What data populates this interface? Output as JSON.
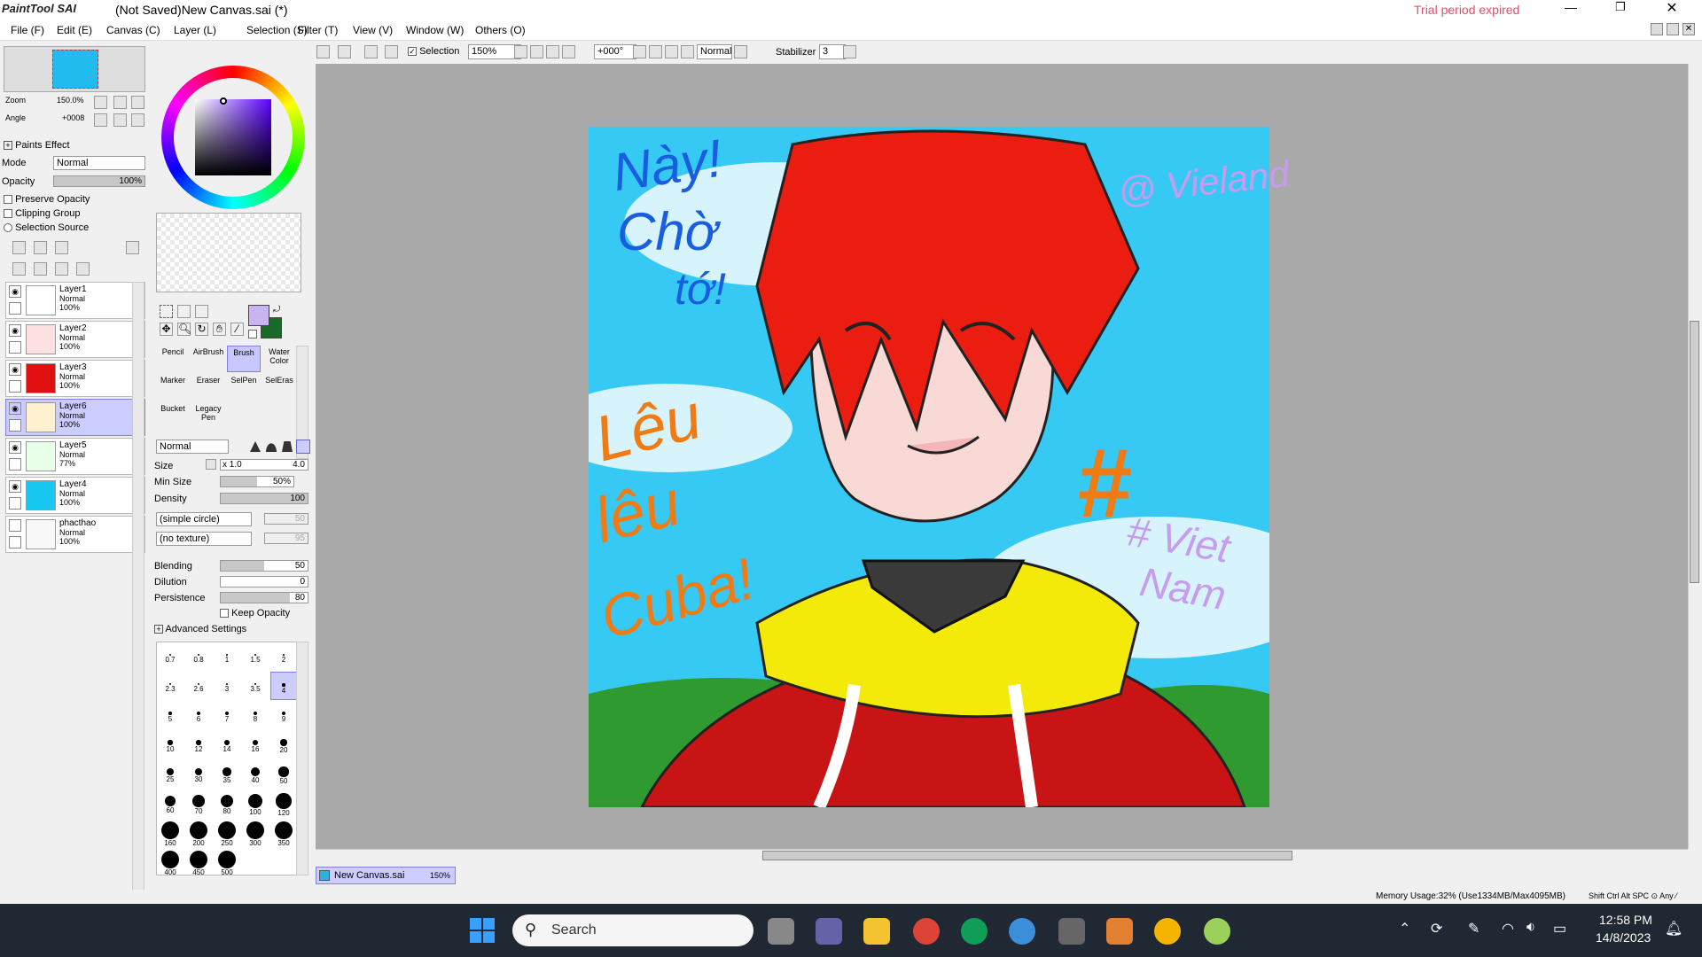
{
  "title_bar": {
    "app_logo": "PaintTool SAI",
    "title": "(Not Saved)New Canvas.sai (*)",
    "trial": "Trial period expired"
  },
  "menu": [
    "File (F)",
    "Edit (E)",
    "Canvas (C)",
    "Layer (L)",
    "Selection (S)",
    "Filter (T)",
    "View (V)",
    "Window (W)",
    "Others (O)"
  ],
  "toolbar": {
    "selection_label": "Selection",
    "zoom_value": "150%",
    "angle_value": "+000°",
    "blend_value": "Normal",
    "stabilizer_label": "Stabilizer",
    "stabilizer_value": "3"
  },
  "navigator": {
    "zoom_label": "Zoom",
    "zoom_value": "150.0%",
    "angle_label": "Angle",
    "angle_value": "+0008"
  },
  "paints_effect": {
    "header": "Paints Effect",
    "mode_label": "Mode",
    "mode_value": "Normal",
    "opacity_label": "Opacity",
    "opacity_value": "100%",
    "opacity_fraction": 1.0,
    "preserve_opacity": "Preserve Opacity",
    "clipping_group": "Clipping Group",
    "selection_source": "Selection Source"
  },
  "layers": [
    {
      "name": "Layer1",
      "mode": "Normal",
      "opacity": "100%",
      "visible": true,
      "selected": false,
      "thumb": "#ffffff"
    },
    {
      "name": "Layer2",
      "mode": "Normal",
      "opacity": "100%",
      "visible": true,
      "selected": false,
      "thumb": "#ffe0e0"
    },
    {
      "name": "Layer3",
      "mode": "Normal",
      "opacity": "100%",
      "visible": true,
      "selected": false,
      "thumb": "#e01010"
    },
    {
      "name": "Layer6",
      "mode": "Normal",
      "opacity": "100%",
      "visible": true,
      "selected": true,
      "thumb": "#fff0d0"
    },
    {
      "name": "Layer5",
      "mode": "Normal",
      "opacity": "77%",
      "visible": true,
      "selected": false,
      "thumb": "#e8ffe8"
    },
    {
      "name": "Layer4",
      "mode": "Normal",
      "opacity": "100%",
      "visible": true,
      "selected": false,
      "thumb": "#18c8f0"
    },
    {
      "name": "phacthao",
      "mode": "Normal",
      "opacity": "100%",
      "visible": false,
      "selected": false,
      "thumb": "#f8f8f8"
    }
  ],
  "colors": {
    "primary": "#c8b4f0",
    "secondary": "#1a6a2a",
    "accent": "#e82010"
  },
  "tools": [
    {
      "label": "Pencil",
      "selected": false
    },
    {
      "label": "AirBrush",
      "selected": false
    },
    {
      "label": "Brush",
      "selected": true
    },
    {
      "label": "Water Color",
      "selected": false
    },
    {
      "label": "Marker",
      "selected": false
    },
    {
      "label": "Eraser",
      "selected": false
    },
    {
      "label": "SelPen",
      "selected": false
    },
    {
      "label": "SelEras",
      "selected": false
    },
    {
      "label": "Bucket",
      "selected": false
    },
    {
      "label": "Legacy Pen",
      "selected": false
    }
  ],
  "brush": {
    "blend_mode": "Normal",
    "size_label": "Size",
    "size_mult": "x 1.0",
    "size_value": "4.0",
    "min_size_label": "Min Size",
    "min_size_value": "50%",
    "min_size_fraction": 0.5,
    "density_label": "Density",
    "density_value": "100",
    "density_fraction": 1.0,
    "shape": "(simple circle)",
    "shape_value": "50",
    "texture": "(no texture)",
    "texture_value": "95",
    "blending_label": "Blending",
    "blending_value": "50",
    "blending_fraction": 0.5,
    "dilution_label": "Dilution",
    "dilution_value": "0",
    "dilution_fraction": 0.0,
    "persistence_label": "Persistence",
    "persistence_value": "80",
    "persistence_fraction": 0.8,
    "keep_opacity": "Keep Opacity",
    "advanced": "Advanced Settings"
  },
  "brush_sizes": [
    "0.7",
    "0.8",
    "1",
    "1.5",
    "2",
    "2.3",
    "2.6",
    "3",
    "3.5",
    "4",
    "5",
    "6",
    "7",
    "8",
    "9",
    "10",
    "12",
    "14",
    "16",
    "20",
    "25",
    "30",
    "35",
    "40",
    "50",
    "60",
    "70",
    "80",
    "100",
    "120",
    "160",
    "200",
    "250",
    "300",
    "350",
    "400",
    "450",
    "500"
  ],
  "selected_brush_size": "4",
  "canvas_text": {
    "t1": "Này!",
    "t2": "Chờ",
    "t3": "tớ!",
    "t4": "Lêu",
    "t5": "lêu",
    "t6": "Cuba!",
    "t7": "@ Vieland",
    "t8": "#",
    "t9": "# Viet",
    "t10": "Nam"
  },
  "tab": {
    "name": "New Canvas.sai",
    "zoom": "150%"
  },
  "status": {
    "memory": "Memory Usage:32% (Use1334MB/Max4095MB)",
    "keys": "Shift Ctrl Alt SPC ⊙ Any ⁄"
  },
  "taskbar": {
    "search": "Search",
    "time": "12:58 PM",
    "date": "14/8/2023"
  }
}
